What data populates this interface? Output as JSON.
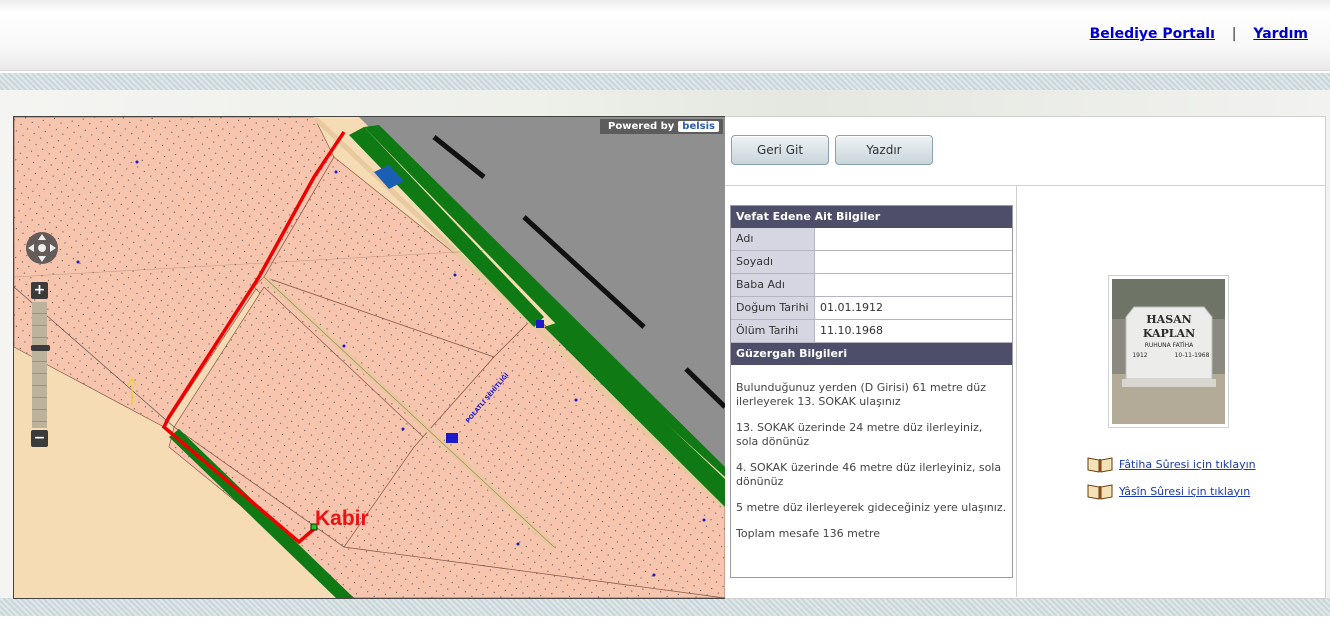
{
  "header": {
    "links": [
      {
        "label": "Belediye Portalı"
      },
      {
        "label": "Yardım"
      }
    ],
    "separator": "|"
  },
  "map": {
    "powered_by": "Powered by",
    "brand": "belsis",
    "marker_label": "Kabir",
    "street_label": "POLATLI ŞEHİTLİĞİ",
    "zoom_in": "+",
    "zoom_out": "−",
    "colors": {
      "parcel": "#f7c4ad",
      "ground": "#f6dcb5",
      "road": "#8f8f8f",
      "green": "#0f7a13",
      "route": "#ee0000",
      "water": "#1b5fb5"
    }
  },
  "toolbar": {
    "back_label": "Geri Git",
    "print_label": "Yazdır"
  },
  "deceased": {
    "heading": "Vefat Edene Ait Bilgiler",
    "fields": [
      {
        "label": "Adı",
        "value": ""
      },
      {
        "label": "Soyadı",
        "value": ""
      },
      {
        "label": "Baba Adı",
        "value": ""
      },
      {
        "label": "Doğum Tarihi",
        "value": "01.01.1912"
      },
      {
        "label": "Ölüm Tarihi",
        "value": "11.10.1968"
      }
    ]
  },
  "route": {
    "heading": "Güzergah Bilgileri",
    "steps": [
      "Bulunduğunuz yerden (D Girisi) 61 metre düz ilerleyerek 13. SOKAK ulaşınız",
      "13. SOKAK üzerinde 24 metre düz ilerleyiniz, sola dönünüz",
      "4. SOKAK üzerinde 46 metre düz ilerleyiniz, sola dönünüz",
      "5 metre düz ilerleyerek gideceğiniz yere ulaşınız.",
      "Toplam mesafe 136 metre"
    ]
  },
  "photo": {
    "lines": [
      "HASAN",
      "KAPLAN",
      "RUHUNA FATİHA",
      "1912",
      "10-11-1968"
    ]
  },
  "prayers": [
    {
      "label": "Fâtiha Sûresi için tıklayın",
      "icon": "open-book-icon"
    },
    {
      "label": "Yâsîn Sûresi için tıklayın",
      "icon": "open-book-icon"
    }
  ]
}
